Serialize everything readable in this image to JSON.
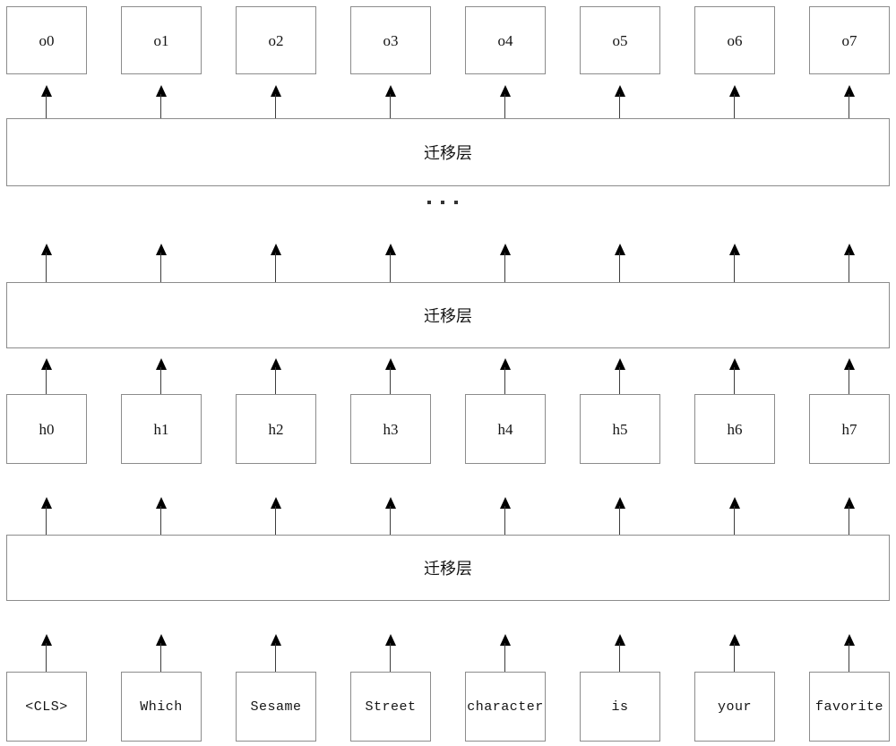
{
  "diagram": {
    "title_text": "",
    "layer_label": "迁移层",
    "ellipsis_label": "...",
    "output_row": {
      "name": "output-nodes",
      "items": [
        {
          "label": "o0"
        },
        {
          "label": "o1"
        },
        {
          "label": "o2"
        },
        {
          "label": "o3"
        },
        {
          "label": "o4"
        },
        {
          "label": "o5"
        },
        {
          "label": "o6"
        },
        {
          "label": "o7"
        }
      ]
    },
    "hidden_row": {
      "name": "hidden-nodes",
      "items": [
        {
          "label": "h0"
        },
        {
          "label": "h1"
        },
        {
          "label": "h2"
        },
        {
          "label": "h3"
        },
        {
          "label": "h4"
        },
        {
          "label": "h5"
        },
        {
          "label": "h6"
        },
        {
          "label": "h7"
        }
      ]
    },
    "token_row": {
      "name": "input-tokens",
      "items": [
        {
          "label": "<CLS>"
        },
        {
          "label": "Which"
        },
        {
          "label": "Sesame"
        },
        {
          "label": "Street"
        },
        {
          "label": "character"
        },
        {
          "label": "is"
        },
        {
          "label": "your"
        },
        {
          "label": "favorite"
        }
      ]
    },
    "layers": [
      {
        "label": "迁移层"
      },
      {
        "label": "迁移层"
      },
      {
        "label": "迁移层"
      }
    ],
    "colors": {
      "box_border": "#8c8c8c",
      "arrow": "#000000",
      "text": "#141414",
      "background": "#ffffff"
    }
  }
}
